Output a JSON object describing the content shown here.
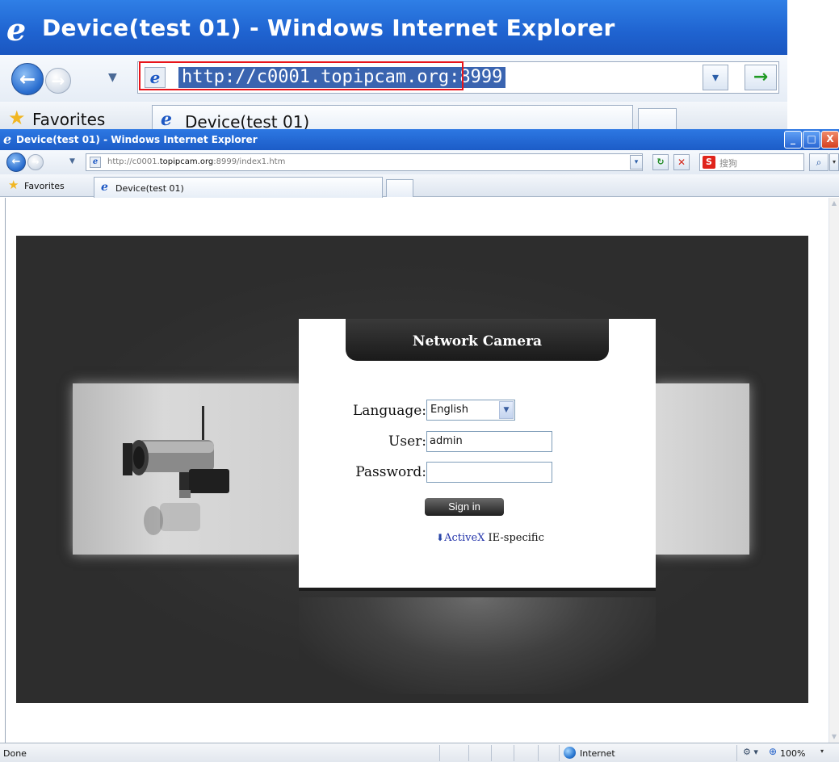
{
  "zoomed": {
    "title": "Device(test 01) - Windows Internet Explorer",
    "url": "http://c0001.topipcam.org:8999",
    "favorites_label": "Favorites",
    "tab_label": "Device(test 01)",
    "highlight_color": "#e8141a"
  },
  "window": {
    "title": "Device(test 01) - Windows Internet Explorer",
    "buttons": {
      "minimize": "_",
      "maximize": "□",
      "close": "X"
    }
  },
  "navbar": {
    "url_prefix": "http://c0001.",
    "url_host": "topipcam.org",
    "url_suffix": ":8999/index1.htm",
    "search_engine_name": "搜狗",
    "search_engine_icon": "S"
  },
  "favbar": {
    "favorites_label": "Favorites",
    "tab_label": "Device(test 01)"
  },
  "login": {
    "header": "Network Camera",
    "language_label": "Language:",
    "language_value": "English",
    "user_label": "User:",
    "user_value": "admin",
    "password_label": "Password:",
    "password_value": "",
    "signin_label": "Sign in",
    "activex_link": "ActiveX",
    "activex_note": "IE-specific"
  },
  "statusbar": {
    "status": "Done",
    "zone": "Internet",
    "zoom": "100%"
  },
  "colors": {
    "titlebar": "#1c5cc7",
    "page_background": "#2d2d2d",
    "login_header": "#1a1a1a"
  }
}
